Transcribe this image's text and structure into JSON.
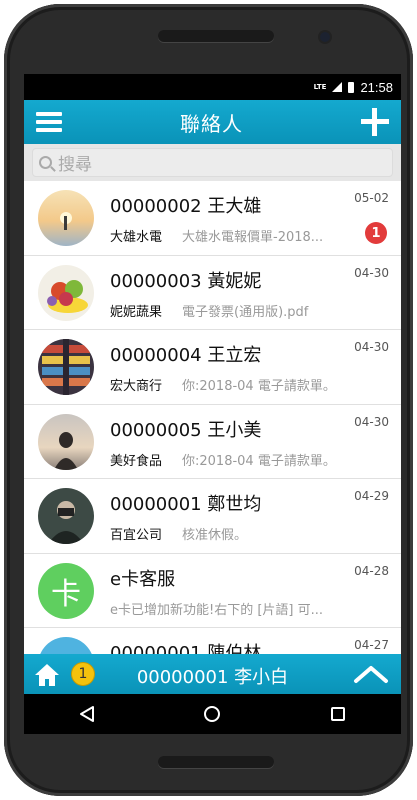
{
  "status": {
    "network": "LTE",
    "time": "21:58"
  },
  "appbar": {
    "title": "聯絡人"
  },
  "search": {
    "placeholder": "搜尋"
  },
  "contacts": [
    {
      "name": "00000002 王大雄",
      "company": "大雄水電",
      "preview": "大雄水電報價單-2018...",
      "date": "05-02",
      "unread": "1"
    },
    {
      "name": "00000003 黃妮妮",
      "company": "妮妮蔬果",
      "preview": "電子發票(通用版).pdf",
      "date": "04-30"
    },
    {
      "name": "00000004 王立宏",
      "company": "宏大商行",
      "preview": "你:2018-04 電子請款單。",
      "date": "04-30"
    },
    {
      "name": "00000005 王小美",
      "company": "美好食品",
      "preview": "你:2018-04 電子請款單。",
      "date": "04-30"
    },
    {
      "name": "00000001 鄭世均",
      "company": "百宜公司",
      "preview": "核准休假。",
      "date": "04-29"
    },
    {
      "name": "e卡客服",
      "company": "",
      "preview": "e卡已增加新功能!右下的 [片語] 可...",
      "date": "04-28",
      "avatar_text": "卡"
    },
    {
      "name": "00000001 陳伯林",
      "company": "",
      "preview": "",
      "date": "04-27"
    }
  ],
  "bottombar": {
    "badge": "1",
    "current_user": "00000001 李小白"
  },
  "icons": {
    "menu": "menu-icon",
    "add": "plus-icon",
    "search": "search-icon",
    "home": "home-icon",
    "expand": "chevron-up-icon"
  },
  "colors": {
    "accent": "#0fa2c8",
    "unread_badge": "#e23b3b",
    "notify_badge": "#f4c20d",
    "ecard_avatar": "#5fcf5f"
  }
}
